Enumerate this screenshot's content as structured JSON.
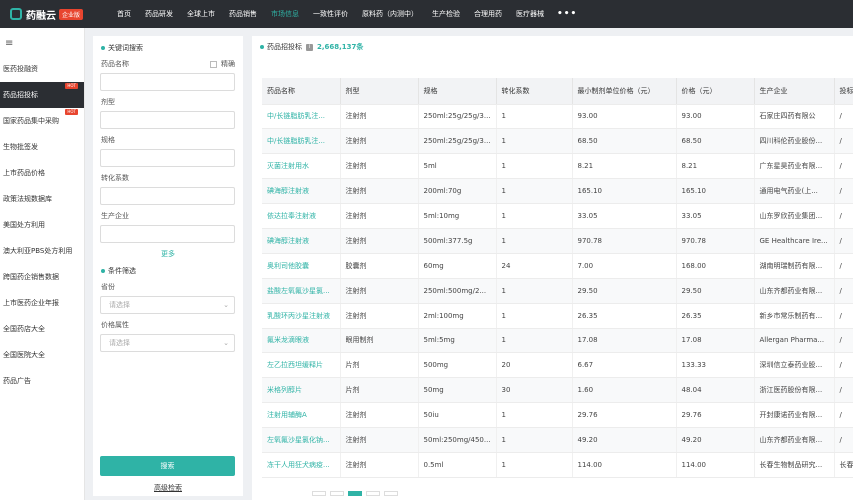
{
  "app": {
    "logo_text": "药融云",
    "edition": "企业版"
  },
  "nav": [
    "首页",
    "药品研发",
    "全球上市",
    "药品销售",
    "市场信息",
    "一致性评价",
    "原料药（内测中）",
    "生产检验",
    "合理用药",
    "医疗器械"
  ],
  "nav_more": "•••",
  "sidebar": {
    "menu_icon": "≡",
    "items": [
      "医药投融资",
      "药品招投标",
      "国家药品集中采购",
      "生物批签发",
      "上市药品价格",
      "政策法规数据库",
      "美国处方利用",
      "澳大利亚PBS处方利用",
      "跨国药企销售数据",
      "上市医药企业年报",
      "全国药店大全",
      "全国医院大全",
      "药品广告"
    ],
    "hot_label": "HOT"
  },
  "search": {
    "keyword_section": "关键词搜索",
    "drug_name_label": "药品名称",
    "exact_label": "精确",
    "dosage_label": "剂型",
    "spec_label": "规格",
    "ratio_label": "转化系数",
    "maker_label": "生产企业",
    "more_label": "更多",
    "filter_section": "条件筛选",
    "province_label": "省份",
    "province_placeholder": "请选择",
    "price_attr_label": "价格属性",
    "price_attr_placeholder": "请选择",
    "search_button": "搜索",
    "advanced_link": "高级检索"
  },
  "results": {
    "title": "药品招投标",
    "count": "2,668,137条",
    "columns": [
      "药品名称",
      "剂型",
      "规格",
      "转化系数",
      "最小制剂单位价格（元）",
      "价格（元）",
      "生产企业",
      "投标"
    ],
    "rows": [
      [
        "中/长链脂肪乳注...",
        "注射剂",
        "250ml:25g/25g/3...",
        "1",
        "93.00",
        "93.00",
        "石家庄四药有限公",
        "/"
      ],
      [
        "中/长链脂肪乳注...",
        "注射剂",
        "250ml:25g/25g/3...",
        "1",
        "68.50",
        "68.50",
        "四川科伦药业股份...",
        "/"
      ],
      [
        "灭菌注射用水",
        "注射剂",
        "5ml",
        "1",
        "8.21",
        "8.21",
        "广东星昊药业有限...",
        "/"
      ],
      [
        "碘海醇注射液",
        "注射剂",
        "200ml:70g",
        "1",
        "165.10",
        "165.10",
        "通用电气药业(上...",
        "/"
      ],
      [
        "依达拉奉注射液",
        "注射剂",
        "5ml:10mg",
        "1",
        "33.05",
        "33.05",
        "山东罗欣药业集团...",
        "/"
      ],
      [
        "碘海醇注射液",
        "注射剂",
        "500ml:377.5g",
        "1",
        "970.78",
        "970.78",
        "GE Healthcare Ire...",
        "/"
      ],
      [
        "奥利司他胶囊",
        "胶囊剂",
        "60mg",
        "24",
        "7.00",
        "168.00",
        "湖南明瑞制药有限...",
        "/"
      ],
      [
        "盐酸左氧氟沙星氯...",
        "注射剂",
        "250ml:500mg/2...",
        "1",
        "29.50",
        "29.50",
        "山东齐都药业有限...",
        "/"
      ],
      [
        "乳酸环丙沙星注射液",
        "注射剂",
        "2ml:100mg",
        "1",
        "26.35",
        "26.35",
        "新乡市常乐制药有...",
        "/"
      ],
      [
        "氟米龙滴眼液",
        "眼用制剂",
        "5ml:5mg",
        "1",
        "17.08",
        "17.08",
        "Allergan Pharma...",
        "/"
      ],
      [
        "左乙拉西坦缓释片",
        "片剂",
        "500mg",
        "20",
        "6.67",
        "133.33",
        "深圳信立泰药业股...",
        "/"
      ],
      [
        "米格列醇片",
        "片剂",
        "50mg",
        "30",
        "1.60",
        "48.04",
        "浙江医药股份有限...",
        "/"
      ],
      [
        "注射用辅酶A",
        "注射剂",
        "50iu",
        "1",
        "29.76",
        "29.76",
        "开封康诺药业有限...",
        "/"
      ],
      [
        "左氧氟沙星氯化钠...",
        "注射剂",
        "50ml:250mg/450...",
        "1",
        "49.20",
        "49.20",
        "山东齐都药业有限...",
        "/"
      ],
      [
        "冻干人用狂犬病疫...",
        "注射剂",
        "0.5ml",
        "1",
        "114.00",
        "114.00",
        "长春生物制品研究...",
        "长春"
      ]
    ]
  },
  "colors": {
    "accent": "#2fb3a6",
    "topbar": "#2b2e33",
    "hot": "#e8452f"
  }
}
